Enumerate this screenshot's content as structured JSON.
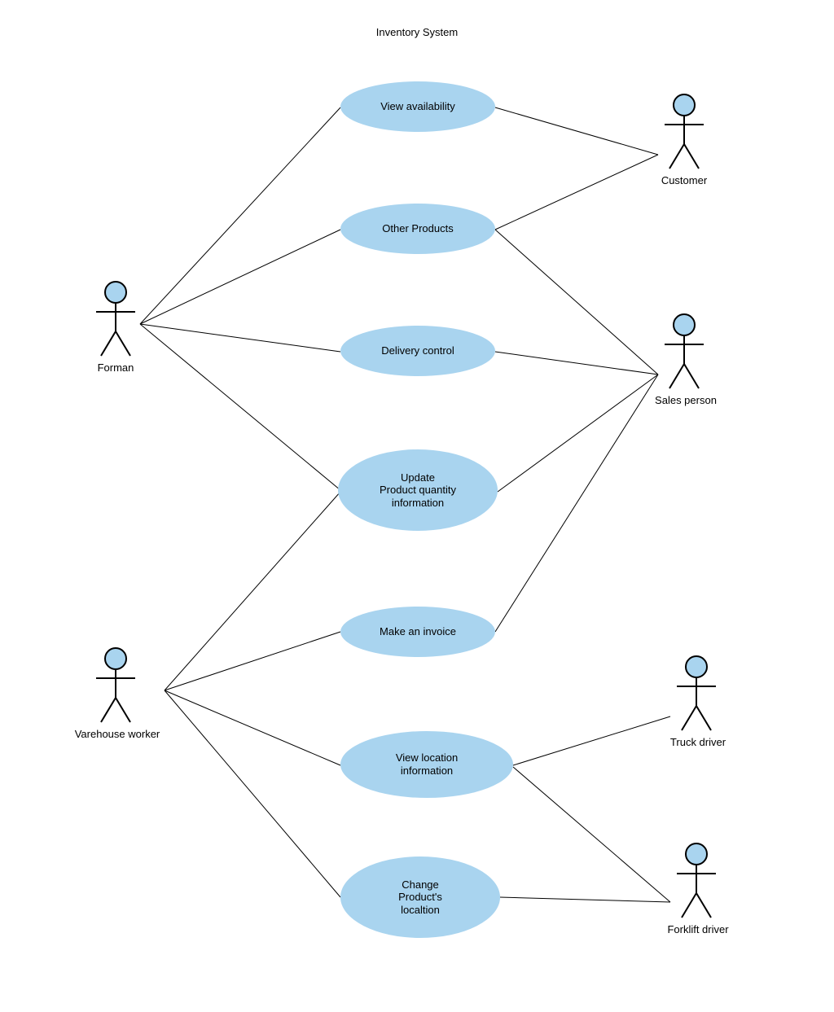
{
  "title": "Inventory System",
  "actors": {
    "forman": {
      "label": "Forman"
    },
    "varehouse": {
      "label": "Varehouse worker"
    },
    "customer": {
      "label": "Customer"
    },
    "sales": {
      "label": "Sales person"
    },
    "truck": {
      "label": "Truck driver"
    },
    "forklift": {
      "label": "Forklift driver"
    }
  },
  "usecases": {
    "uc1": {
      "label": "View availability"
    },
    "uc2": {
      "label": "Other Products"
    },
    "uc3": {
      "label": "Delivery control"
    },
    "uc4": {
      "label": "Update\nProduct quantity\ninformation"
    },
    "uc5": {
      "label": "Make an invoice"
    },
    "uc6": {
      "label": "View location\ninformation"
    },
    "uc7": {
      "label": "Change\nProduct's\nlocaltion"
    }
  },
  "colors": {
    "ellipse": "#a9d4ef",
    "head": "#a9d4ef"
  }
}
